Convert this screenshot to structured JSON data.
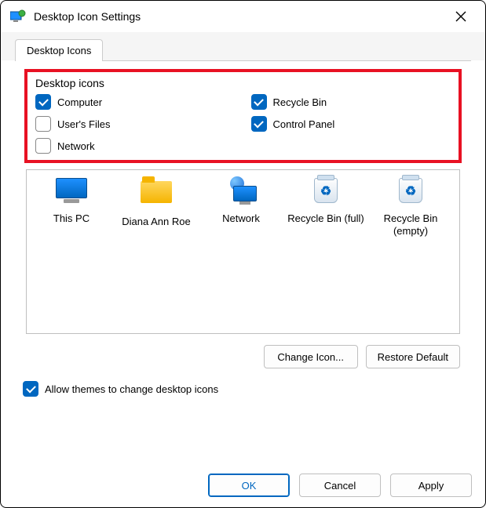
{
  "window": {
    "title": "Desktop Icon Settings"
  },
  "tabs": [
    {
      "label": "Desktop Icons"
    }
  ],
  "group": {
    "title": "Desktop icons",
    "options": [
      {
        "label": "Computer",
        "checked": true
      },
      {
        "label": "Recycle Bin",
        "checked": true
      },
      {
        "label": "User's Files",
        "checked": false
      },
      {
        "label": "Control Panel",
        "checked": true
      },
      {
        "label": "Network",
        "checked": false
      }
    ]
  },
  "icons": [
    {
      "label": "This PC",
      "kind": "monitor"
    },
    {
      "label": "Diana Ann Roe",
      "kind": "folder"
    },
    {
      "label": "Network",
      "kind": "netmon"
    },
    {
      "label": "Recycle Bin (full)",
      "kind": "bin"
    },
    {
      "label": "Recycle Bin (empty)",
      "kind": "bin"
    }
  ],
  "buttons": {
    "change_icon": "Change Icon...",
    "restore_default": "Restore Default",
    "ok": "OK",
    "cancel": "Cancel",
    "apply": "Apply"
  },
  "themes_checkbox": {
    "label": "Allow themes to change desktop icons",
    "checked": true
  },
  "colors": {
    "accent": "#0067c0",
    "highlight_border": "#e81123"
  }
}
